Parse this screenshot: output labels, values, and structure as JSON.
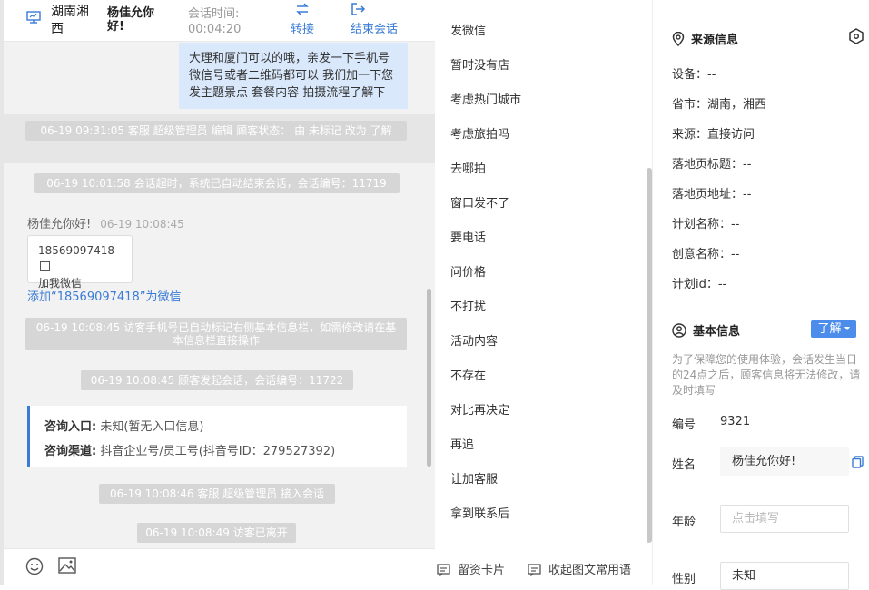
{
  "header": {
    "location": "湖南湘西",
    "visitor_name": "杨佳允你好!",
    "session_time_label": "会话时间:",
    "session_time": "00:04:20",
    "transfer_label": "转接",
    "end_label": "结束会话"
  },
  "chat": {
    "agent_message": "大理和厦门可以的哦，亲发一下手机号微信号或者二维码都可以 我们加一下您发主题景点 套餐内容 拍摄流程了解下",
    "sys1": "06-19 09:31:05 客服 超级管理员 编辑 顾客状态： 由 未标记 改为 了解",
    "sys2": "06-19 10:01:58 会话超时，系统已自动结束会话，会话编号：11719",
    "sender_name": "杨佳允你好!",
    "sender_time": "06-19 10:08:45",
    "card_phone": "18569097418",
    "card_text": "加我微信",
    "add_link": "添加“18569097418”为微信",
    "sys3": "06-19 10:08:45 访客手机号已自动标记右侧基本信息栏，如需修改请在基本信息栏直接操作",
    "sys4": "06-19 10:08:45 顾客发起会话，会话编号：11722",
    "consult_entry_label": "咨询入口:",
    "consult_entry_value": "未知(暂无入口信息)",
    "consult_channel_label": "咨询渠道:",
    "consult_channel_value": "抖音企业号/员工号(抖音号ID：279527392)",
    "sys5": "06-19 10:08:46 客服 超级管理员 接入会话",
    "sys6": "06-19 10:08:49 访客已离开"
  },
  "phrases": [
    "发微信",
    "暂时没有店",
    "考虑热门城市",
    "考虑旅拍吗",
    "去哪拍",
    "窗口发不了",
    "要电话",
    "问价格",
    "不打扰",
    "活动内容",
    "不存在",
    "对比再决定",
    "再追",
    "让加客服",
    "拿到联系后"
  ],
  "phrase_footer": {
    "card_label": "留资卡片",
    "collapse_label": "收起图文常用语"
  },
  "source_info": {
    "title": "来源信息",
    "rows": [
      "设备：--",
      "省市：湖南，湘西",
      "来源：直接访问",
      "落地页标题：--",
      "落地页地址：--",
      "计划名称：--",
      "创意名称：--",
      "计划id：--"
    ]
  },
  "basic_info": {
    "title": "基本信息",
    "status_button": "了解",
    "note": "为了保障您的使用体验，会话发生当日的24点之后，顾客信息将无法修改，请及时填写",
    "id_label": "编号",
    "id_value": "9321",
    "name_label": "姓名",
    "name_value": "杨佳允你好!",
    "age_label": "年龄",
    "age_placeholder": "点击填写",
    "gender_label": "性别",
    "gender_value": "未知"
  },
  "colors": {
    "accent": "#3a7bd5",
    "bubble": "#d9e8fb",
    "system_msg": "#d6d6d6"
  }
}
